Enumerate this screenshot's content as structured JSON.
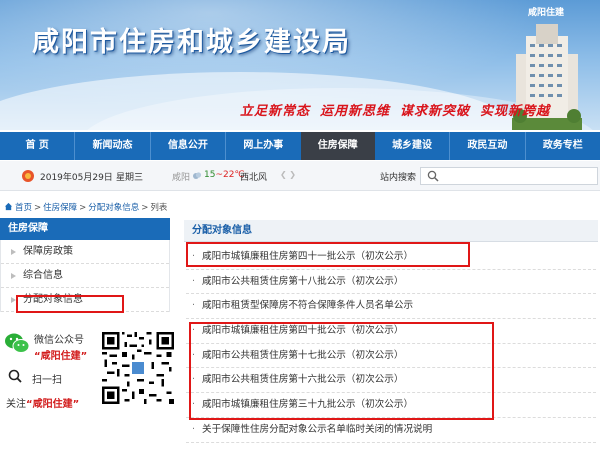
{
  "banner": {
    "title": "咸阳市住房和城乡建设局",
    "logo_text": "咸阳住建",
    "slogans": [
      "立足新常态",
      "运用新思维",
      "谋求新突破",
      "实现新跨越"
    ]
  },
  "nav": {
    "items": [
      {
        "label": "首 页"
      },
      {
        "label": "新闻动态"
      },
      {
        "label": "信息公开"
      },
      {
        "label": "网上办事"
      },
      {
        "label": "住房保障",
        "active": true
      },
      {
        "label": "城乡建设"
      },
      {
        "label": "政民互动"
      },
      {
        "label": "政务专栏"
      }
    ]
  },
  "infobar": {
    "date": "2019年05月29日",
    "weekday": "星期三",
    "city": "咸阳",
    "temp_low": "15",
    "temp_high": "~22℃",
    "wind": "西北风",
    "search_label": "站内搜索"
  },
  "breadcrumb": {
    "items": [
      "首页",
      "住房保障",
      "分配对象信息"
    ],
    "current": "列表"
  },
  "sidebar": {
    "heading": "住房保障",
    "items": [
      {
        "label": "保障房政策"
      },
      {
        "label": "综合信息"
      },
      {
        "label": "分配对象信息"
      }
    ]
  },
  "wechat": {
    "line1": "微信公众号",
    "line2": "“咸阳住建”",
    "scan": "扫一扫",
    "follow_prefix": "关注",
    "follow_name": "“咸阳住建”"
  },
  "content": {
    "heading": "分配对象信息",
    "items": [
      "咸阳市城镇廉租住房第四十一批公示（初次公示）",
      "咸阳市公共租赁住房第十八批公示（初次公示）",
      "咸阳市租赁型保障房不符合保障条件人员名单公示",
      "咸阳市城镇廉租住房第四十批公示（初次公示）",
      "咸阳市公共租赁住房第十七批公示（初次公示）",
      "咸阳市公共租赁住房第十六批公示（初次公示）",
      "咸阳市城镇廉租住房第三十九批公示（初次公示）",
      "关于保障性住房分配对象公示名单临时关闭的情况说明"
    ]
  },
  "colors": {
    "nav_bg": "#1a6bb8",
    "nav_active": "#3a3f47",
    "highlight_red": "#e01717",
    "slogan_red": "#d9141b"
  }
}
